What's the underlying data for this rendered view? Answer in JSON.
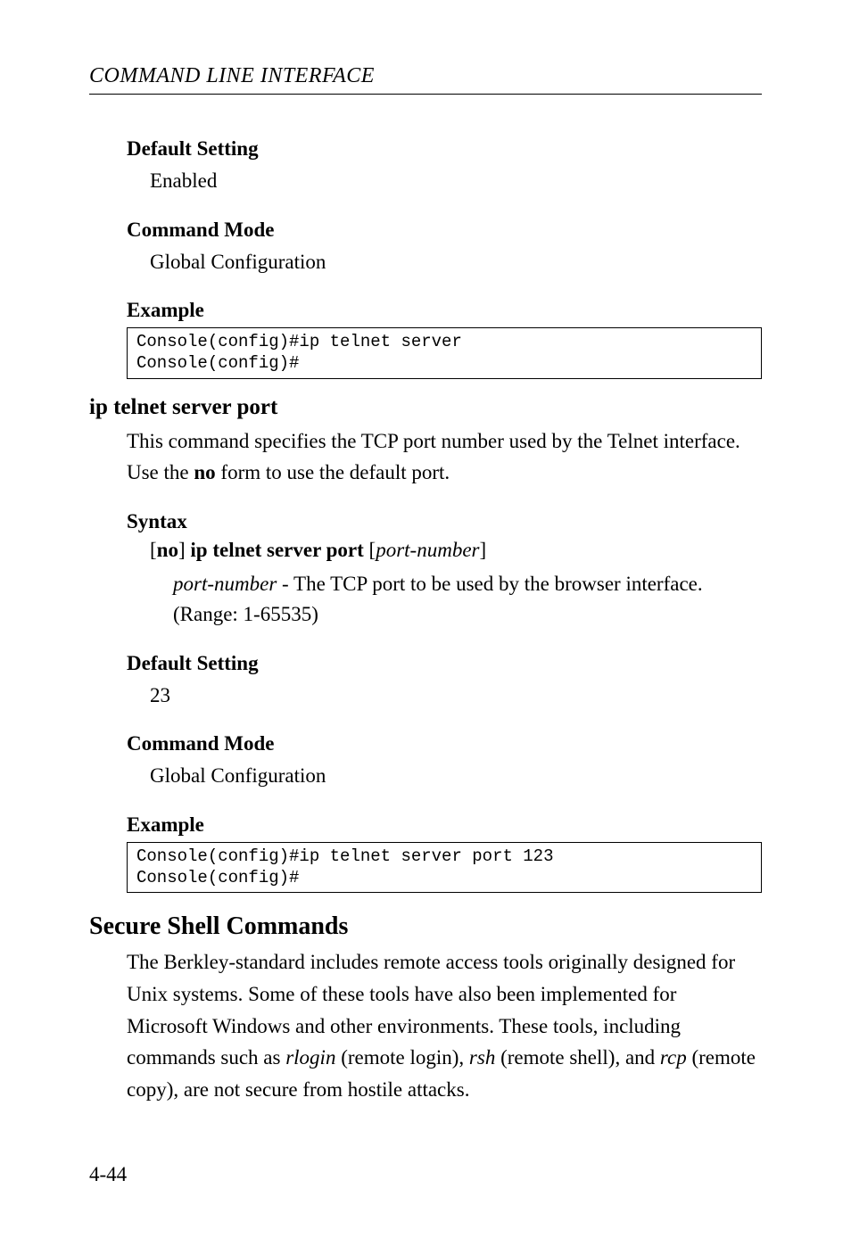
{
  "running_head": "COMMAND LINE INTERFACE",
  "block1": {
    "default_setting_label": "Default Setting",
    "default_setting_body": "Enabled",
    "command_mode_label": "Command Mode",
    "command_mode_body": "Global Configuration",
    "example_label": "Example",
    "example_code": "Console(config)#ip telnet server\nConsole(config)#"
  },
  "subsection": {
    "title": "ip telnet server port",
    "intro_a": "This command specifies the TCP port number used by the Telnet interface. Use the ",
    "intro_bold": "no",
    "intro_b": " form to use the default port.",
    "syntax_label": "Syntax",
    "syntax_br1": "[",
    "syntax_no": "no",
    "syntax_br2": "] ",
    "syntax_main": "ip telnet server port",
    "syntax_space": " [",
    "syntax_param": "port-number",
    "syntax_close": "]",
    "param_name": "port-number",
    "param_desc": " - The TCP port to be used by the browser interface. (Range: 1-65535)",
    "default_setting_label": "Default Setting",
    "default_setting_body": "23",
    "command_mode_label": "Command Mode",
    "command_mode_body": "Global Configuration",
    "example_label": "Example",
    "example_code": "Console(config)#ip telnet server port 123\nConsole(config)#"
  },
  "main": {
    "title": "Secure Shell Commands",
    "body_a": "The Berkley-standard includes remote access tools originally designed for Unix systems. Some of these tools have also been implemented for Microsoft Windows and other environments. These tools, including commands such as ",
    "rlogin": "rlogin",
    "body_b": " (remote login), ",
    "rsh": "rsh",
    "body_c": " (remote shell), and ",
    "rcp": "rcp",
    "body_d": " (remote copy), are not secure from hostile attacks."
  },
  "page_number": "4-44"
}
